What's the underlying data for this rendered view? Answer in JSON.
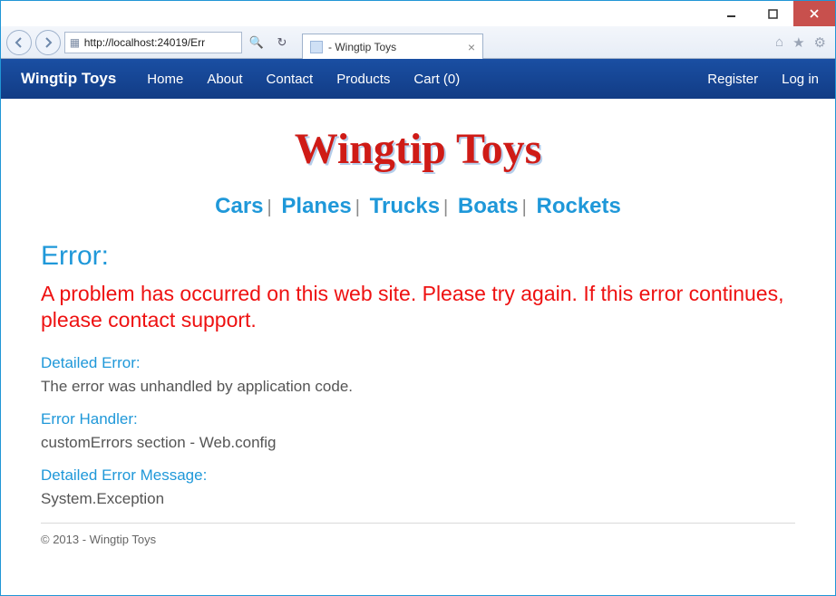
{
  "browser": {
    "url": "http://localhost:24019/Err",
    "tab_title": " - Wingtip Toys"
  },
  "nav": {
    "brand": "Wingtip Toys",
    "links": [
      "Home",
      "About",
      "Contact",
      "Products",
      "Cart (0)"
    ],
    "right": [
      "Register",
      "Log in"
    ]
  },
  "logo": "Wingtip Toys",
  "categories": [
    "Cars",
    "Planes",
    "Trucks",
    "Boats",
    "Rockets"
  ],
  "error": {
    "heading": "Error:",
    "message": "A problem has occurred on this web site. Please try again. If this error continues, please contact support.",
    "detailed_label": "Detailed Error:",
    "detailed_value": "The error was unhandled by application code.",
    "handler_label": "Error Handler:",
    "handler_value": "customErrors section - Web.config",
    "msg_label": "Detailed Error Message:",
    "msg_value": "System.Exception"
  },
  "footer": "© 2013 - Wingtip Toys"
}
